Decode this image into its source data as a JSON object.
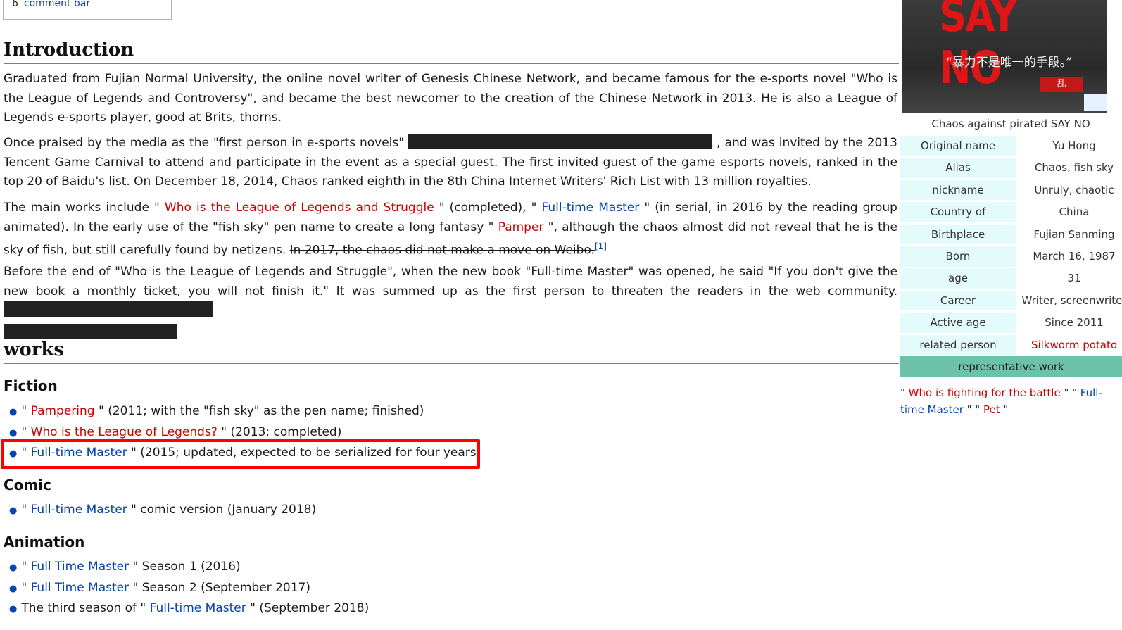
{
  "toc": {
    "number": "6",
    "label": "comment bar"
  },
  "intro": {
    "heading": "Introduction",
    "p1": "Graduated from Fujian Normal University, the online novel writer of Genesis Chinese Network, and became famous for the e-sports novel \"Who is the League of Legends and Controversy\", and became the best newcomer to the creation of the Chinese Network in 2013. He is also a League of Legends e-sports player, good at Brits, thorns.",
    "p2_a": "Once praised by the media as the \"first person in e-sports novels\"",
    "p2_b": ", and was invited by the 2013 Tencent Game Carnival to attend and participate in the event as a special guest. The first invited guest of the game esports novels, ranked in the top 20 of Baidu's list. On December 18, 2014, Chaos ranked eighth in the 8th China Internet Writers' Rich List with 13 million royalties.",
    "p3_a": "The main works include \" ",
    "p3_link1": "Who is the League of Legends and Struggle",
    "p3_b": " \" (completed), \" ",
    "p3_link2": "Full-time Master",
    "p3_c": " \" (in serial, in 2016 by the reading group animated). In the early use of the \"fish sky\" pen name to create a long fantasy \" ",
    "p3_link3": "Pamper",
    "p3_d": " \", although the chaos almost did not reveal that he is the sky of fish, but still carefully found by netizens. ",
    "p3_strike": "In 2017, the chaos did not make a move on Weibo.",
    "p3_ref": "[1]",
    "p4": "Before the end of \"Who is the League of Legends and Struggle\", when the new book \"Full-time Master\" was opened, he said \"If you don't give the new book a monthly ticket, you will not finish it.\" It was summed up as the first person to threaten the readers in the web community."
  },
  "works": {
    "heading": "works",
    "fiction": {
      "heading": "Fiction",
      "items": [
        {
          "pre": "\" ",
          "link": "Pampering",
          "link_color": "red",
          "post": " \" (2011; with the \"fish sky\" as the pen name; finished)"
        },
        {
          "pre": "\" ",
          "link": "Who is the League of Legends?",
          "link_color": "red",
          "post": " \" (2013; completed)"
        },
        {
          "pre": "\" ",
          "link": "Full-time Master",
          "link_color": "blue",
          "post": " \" (2015; updated, expected to be serialized for four years)"
        }
      ]
    },
    "comic": {
      "heading": "Comic",
      "items": [
        {
          "pre": "\" ",
          "link": "Full-time Master",
          "link_color": "blue",
          "post": " \" comic version (January 2018)"
        }
      ]
    },
    "animation": {
      "heading": "Animation",
      "items": [
        {
          "pre": "\" ",
          "link": "Full Time Master",
          "link_color": "blue",
          "post": " \" Season 1 (2016)"
        },
        {
          "pre": "\" ",
          "link": "Full Time Master",
          "link_color": "blue",
          "post": " \" Season 2 (September 2017)"
        },
        {
          "pre": "The third season of \" ",
          "link": "Full-time Master",
          "link_color": "blue",
          "post": " \" (September 2018)"
        }
      ]
    }
  },
  "infobox": {
    "image_text": "SAY NO",
    "image_cn": "“暴力不是唯一的手段。”",
    "image_seal": "乱",
    "caption": "Chaos against pirated SAY NO",
    "rows": [
      {
        "key": "Original name",
        "value": "Yu Hong"
      },
      {
        "key": "Alias",
        "value": "Chaos, fish sky"
      },
      {
        "key": "nickname",
        "value": "Unruly, chaotic"
      },
      {
        "key": "Country of Citizenship",
        "value": "China"
      },
      {
        "key": "Birthplace",
        "value": "Fujian Sanming"
      },
      {
        "key": "Born",
        "value": "March 16, 1987"
      },
      {
        "key": "age",
        "value": "31"
      },
      {
        "key": "Career",
        "value": "Writer, screenwriter"
      },
      {
        "key": "Active age",
        "value": "Since 2011"
      },
      {
        "key": "related person",
        "value": "Silkworm potato",
        "value_color": "red"
      }
    ],
    "rep_heading": "representative work",
    "rep_works": [
      {
        "text": "Who is fighting for the battle",
        "color": "red"
      },
      {
        "text": "Full-time Master",
        "color": "blue"
      },
      {
        "text": "Pet",
        "color": "red"
      }
    ]
  },
  "colors": {
    "red_link": "#cc0000",
    "blue_link": "#0645ad",
    "highlight": "#ff0000",
    "infobox_key_bg": "#e4fbfb",
    "infobox_head_bg": "#6cc2a8"
  }
}
